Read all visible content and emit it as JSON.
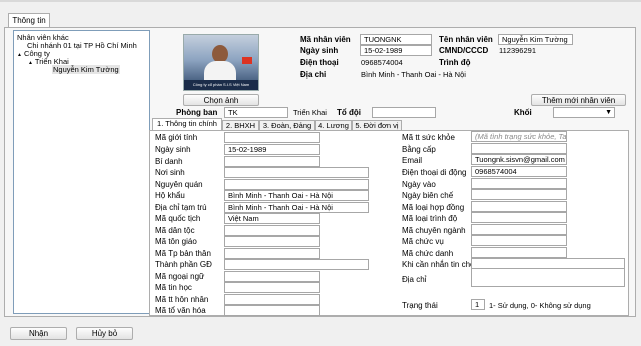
{
  "window": {
    "tab_label": "Thông tin"
  },
  "tree": {
    "items": [
      {
        "label": "Nhân viên khác",
        "level": 0
      },
      {
        "label": "Chi nhánh 01 tại TP Hồ Chí Minh",
        "level": 0
      },
      {
        "label": "Công ty",
        "level": 0,
        "expander": "▲"
      },
      {
        "label": "Triển Khai",
        "level": 1,
        "expander": "▲"
      },
      {
        "label": "Nguyễn Kim Tường",
        "level": 2,
        "selected": true
      }
    ]
  },
  "photo": {
    "banner_text": "Công ty cổ phần S.I.S Việt Nam",
    "choose_button": "Chọn ảnh"
  },
  "header": {
    "ma_nv_label": "Mã nhân viên",
    "ma_nv_value": "TUONGNK",
    "ten_nv_label": "Tên nhân viên",
    "ten_nv_value": "Nguyễn Kim Tường",
    "ngay_sinh_label": "Ngày sinh",
    "ngay_sinh_value": "15-02-1989",
    "cmnd_label": "CMND/CCCD",
    "cmnd_value": "112396291",
    "dien_thoai_label": "Điện thoại",
    "dien_thoai_value": "0968574004",
    "trinh_do_label": "Trình độ",
    "dia_chi_label": "Địa chỉ",
    "dia_chi_value": "Bình Minh - Thanh Oai - Hà Nội"
  },
  "filters": {
    "phong_ban_label": "Phòng ban",
    "phong_ban_code": "TK",
    "phong_ban_name": "Triển Khai",
    "to_doi_label": "Tổ đội",
    "khoi_label": "Khối",
    "add_button": "Thêm mới nhân viên"
  },
  "tabs": [
    {
      "label": "1. Thông tin chính",
      "active": true
    },
    {
      "label": "2. BHXH"
    },
    {
      "label": "3. Đoàn, Đảng"
    },
    {
      "label": "4. Lương"
    },
    {
      "label": "5. Đời đơn vị"
    }
  ],
  "form_left": [
    {
      "label": "Mã giới tính",
      "value": ""
    },
    {
      "label": "Ngày sinh",
      "value": "15-02-1989"
    },
    {
      "label": "Bí danh",
      "value": ""
    },
    {
      "label": "Nơi sinh",
      "value": ""
    },
    {
      "label": "Nguyên quán",
      "value": ""
    },
    {
      "label": "Hộ khẩu",
      "value": "Bình Minh - Thanh Oai - Hà Nội"
    },
    {
      "label": "Địa chỉ tạm trú",
      "value": "Bình Minh - Thanh Oai - Hà Nội"
    },
    {
      "label": "Mã quốc tịch",
      "value": "Việt Nam"
    },
    {
      "label": "Mã dân tộc",
      "value": ""
    },
    {
      "label": "Mã tôn giáo",
      "value": ""
    },
    {
      "label": "Mã Tp bản thân",
      "value": ""
    },
    {
      "label": "Thành phần GĐ",
      "value": ""
    },
    {
      "label": "Mã ngoại ngữ",
      "value": ""
    },
    {
      "label": "Mã tin học",
      "value": ""
    },
    {
      "label": "Mã tt hôn nhân",
      "value": ""
    },
    {
      "label": "Mã tổ văn hóa",
      "value": ""
    }
  ],
  "form_right": [
    {
      "label": "Mã tt sức khỏe",
      "value": "",
      "placeholder": "(Mã tình trạng sức khỏe, Ta"
    },
    {
      "label": "Bằng cấp",
      "value": ""
    },
    {
      "label": "Email",
      "value": "Tuongnk.sisvn@gmail.com"
    },
    {
      "label": "Điện thoại di động",
      "value": "0968574004"
    },
    {
      "label": "Ngày vào",
      "value": ""
    },
    {
      "label": "Ngày biên chế",
      "value": ""
    },
    {
      "label": "Mã loại hợp đồng",
      "value": ""
    },
    {
      "label": "Mã loại trình độ",
      "value": ""
    },
    {
      "label": "Mã chuyên ngành",
      "value": ""
    },
    {
      "label": "Mã chức vụ",
      "value": ""
    },
    {
      "label": "Mã chức danh",
      "value": ""
    },
    {
      "label": "Khi cần nhắn tin cho",
      "value": ""
    },
    {
      "label": "Địa chỉ",
      "value": ""
    }
  ],
  "status": {
    "label": "Trạng thái",
    "value": "1",
    "hint": "1- Sử dụng, 0- Không sử dụng"
  },
  "footer": {
    "ok_button": "Nhận",
    "cancel_button": "Hủy bỏ"
  }
}
